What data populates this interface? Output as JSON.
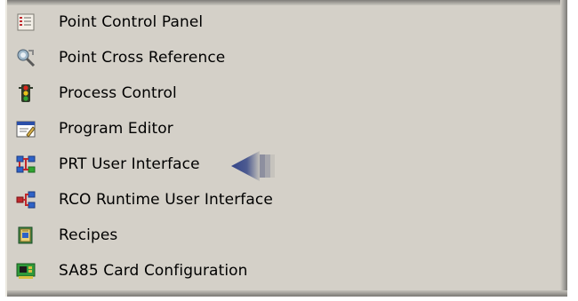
{
  "menu": {
    "items": [
      {
        "label": "Point Control Panel",
        "icon": "point-control-panel-icon"
      },
      {
        "label": "Point Cross Reference",
        "icon": "point-cross-reference-icon"
      },
      {
        "label": "Process Control",
        "icon": "process-control-icon"
      },
      {
        "label": "Program Editor",
        "icon": "program-editor-icon"
      },
      {
        "label": "PRT User Interface",
        "icon": "prt-user-interface-icon"
      },
      {
        "label": "RCO Runtime User Interface",
        "icon": "rco-runtime-user-interface-icon"
      },
      {
        "label": "Recipes",
        "icon": "recipes-icon"
      },
      {
        "label": "SA85 Card Configuration",
        "icon": "sa85-card-configuration-icon"
      }
    ]
  },
  "annotation": {
    "icon": "left-pointing-arrow-icon"
  },
  "colors": {
    "panel_background": "#d4d0c8",
    "text": "#000000",
    "arrow": "#3f4f88"
  }
}
